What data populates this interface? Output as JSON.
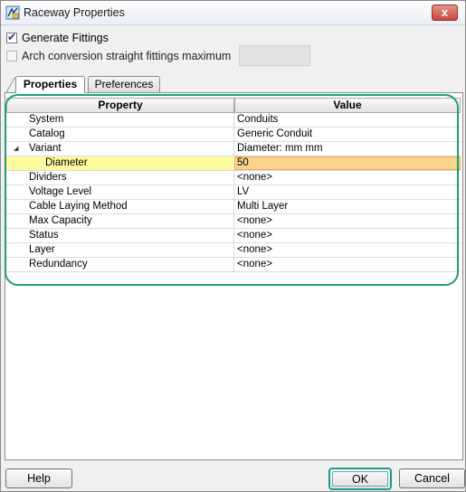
{
  "window": {
    "title": "Raceway Properties",
    "close_glyph": "x"
  },
  "options": {
    "generate_fittings": {
      "label": "Generate Fittings",
      "checked": true
    },
    "arch_conversion": {
      "label": "Arch conversion straight fittings maximum",
      "checked": false,
      "value": ""
    }
  },
  "tabs": [
    {
      "label": "Properties",
      "active": true
    },
    {
      "label": "Preferences",
      "active": false
    }
  ],
  "grid": {
    "headers": {
      "property": "Property",
      "value": "Value"
    },
    "rows": [
      {
        "property": "System",
        "value": "Conduits"
      },
      {
        "property": "Catalog",
        "value": "Generic Conduit"
      },
      {
        "property": "Variant",
        "value": "Diameter: mm mm"
      },
      {
        "property": "Diameter",
        "value": "50"
      },
      {
        "property": "Dividers",
        "value": "<none>"
      },
      {
        "property": "Voltage Level",
        "value": "LV"
      },
      {
        "property": "Cable Laying Method",
        "value": "Multi Layer"
      },
      {
        "property": "Max Capacity",
        "value": "<none>"
      },
      {
        "property": "Status",
        "value": "<none>"
      },
      {
        "property": "Layer",
        "value": "<none>"
      },
      {
        "property": "Redundancy",
        "value": "<none>"
      }
    ],
    "expander_glyph": "◢"
  },
  "buttons": {
    "help": "Help",
    "ok": "OK",
    "cancel": "Cancel"
  },
  "colors": {
    "highlight_outline": "#1f9e7d",
    "selected_property_bg": "#fefb9e",
    "selected_value_bg": "#fbd38f",
    "close_button": "#c6473b"
  },
  "icons": {
    "app": "raceway-app-icon",
    "checkmark": "checkmark-icon",
    "expander": "collapse-triangle-icon"
  }
}
